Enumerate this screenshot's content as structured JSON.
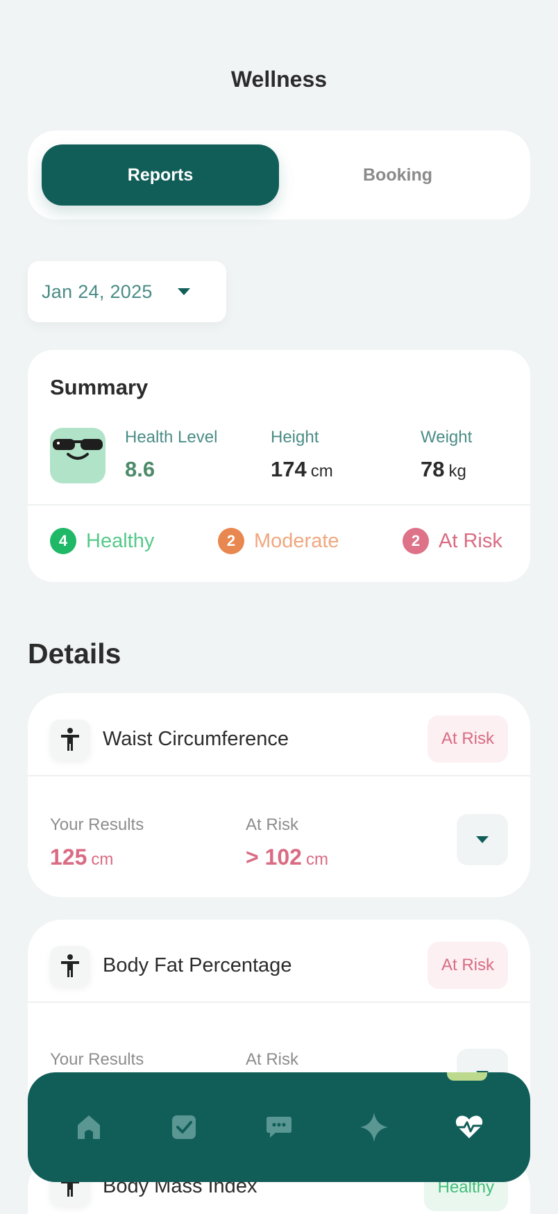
{
  "header": {
    "title": "Wellness"
  },
  "tabs": [
    {
      "label": "Reports",
      "active": true
    },
    {
      "label": "Booking",
      "active": false
    }
  ],
  "date_picker": {
    "value": "Jan 24, 2025"
  },
  "summary": {
    "title": "Summary",
    "health_level": {
      "label": "Health Level",
      "value": "8.6"
    },
    "height": {
      "label": "Height",
      "value": "174",
      "unit": "cm"
    },
    "weight": {
      "label": "Weight",
      "value": "78",
      "unit": "kg"
    },
    "status": [
      {
        "count": "4",
        "label": "Healthy",
        "circle_color": "#1fb866",
        "text_color": "#56c98a"
      },
      {
        "count": "2",
        "label": "Moderate",
        "circle_color": "#e8874f",
        "text_color": "#f0a77f"
      },
      {
        "count": "2",
        "label": "At Risk",
        "circle_color": "#dd7289",
        "text_color": "#d96b82"
      }
    ]
  },
  "details": {
    "title": "Details",
    "cards": [
      {
        "title": "Waist Circumference",
        "badge": "At Risk",
        "results_label": "Your Results",
        "results_value": "125",
        "results_unit": "cm",
        "threshold_label": "At Risk",
        "threshold_value": "> 102",
        "threshold_unit": "cm"
      },
      {
        "title": "Body Fat Percentage",
        "badge": "At Risk",
        "results_label": "Your Results",
        "threshold_label": "At Risk"
      },
      {
        "title": "Body Mass Index",
        "badge": "Healthy"
      }
    ]
  },
  "nav": {
    "items": [
      "home-icon",
      "checklist-icon",
      "chat-icon",
      "sparkle-icon",
      "heart-pulse-icon"
    ],
    "active": "heart-pulse-icon"
  },
  "colors": {
    "primary": "#115e59",
    "background": "#f0f4f4",
    "at_risk": "#d96b82",
    "healthy": "#3fbf78"
  }
}
